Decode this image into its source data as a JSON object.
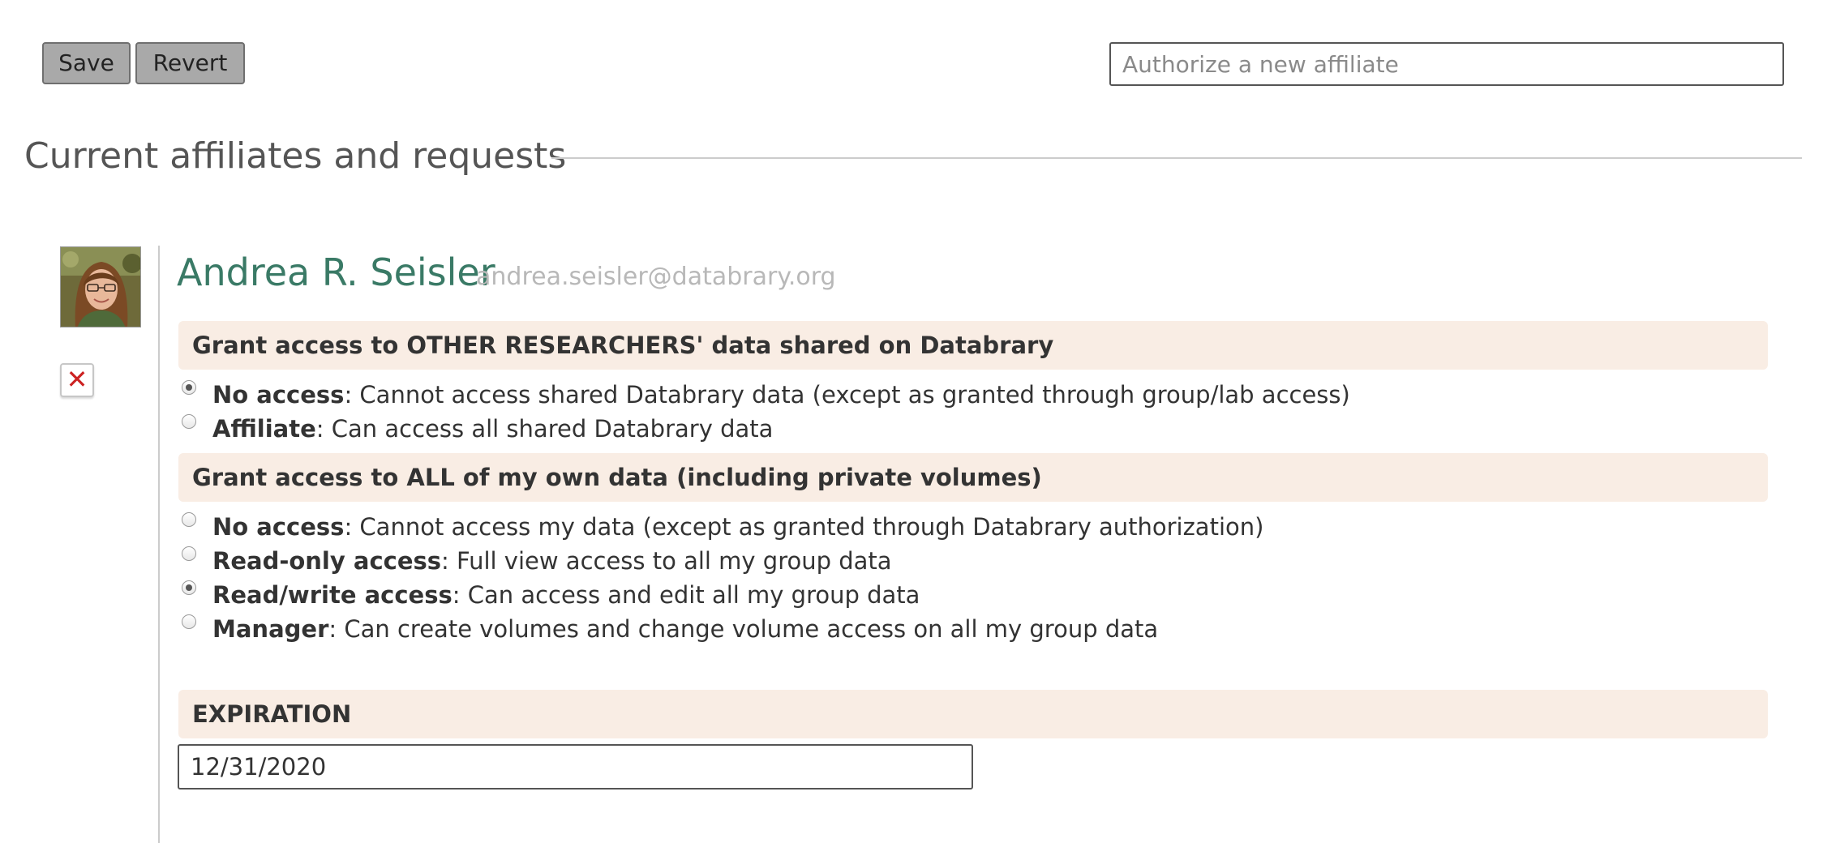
{
  "toolbar": {
    "save_label": "Save",
    "revert_label": "Revert",
    "affiliate_placeholder": "Authorize a new affiliate"
  },
  "section": {
    "title": "Current affiliates and requests"
  },
  "affiliate": {
    "name": "Andrea R. Seisler",
    "email": "andrea.seisler@databrary.org",
    "remove_icon": "close-icon",
    "remove_glyph": "✕",
    "avatar_icon": "avatar-photo"
  },
  "grant_other": {
    "heading": "Grant access to OTHER RESEARCHERS' data shared on Databrary",
    "options": [
      {
        "name": "No access",
        "desc": ": Cannot access shared Databrary data (except as granted through group/lab access)",
        "checked": true
      },
      {
        "name": "Affiliate",
        "desc": ": Can access all shared Databrary data",
        "checked": false
      }
    ]
  },
  "grant_own": {
    "heading": "Grant access to ALL of my own data (including private volumes)",
    "options": [
      {
        "name": "No access",
        "desc": ": Cannot access my data (except as granted through Databrary authorization)",
        "checked": false
      },
      {
        "name": "Read-only access",
        "desc": ": Full view access to all my group data",
        "checked": false
      },
      {
        "name": "Read/write access",
        "desc": ": Can access and edit all my group data",
        "checked": true
      },
      {
        "name": "Manager",
        "desc": ": Can create volumes and change volume access on all my group data",
        "checked": false
      }
    ]
  },
  "expiration": {
    "heading": "EXPIRATION",
    "value": "12/31/2020"
  },
  "colors": {
    "name_green": "#3a7a66",
    "bar_bg": "#f9ede4",
    "button_bg": "#a9a9a9",
    "remove_red": "#cc2222"
  }
}
